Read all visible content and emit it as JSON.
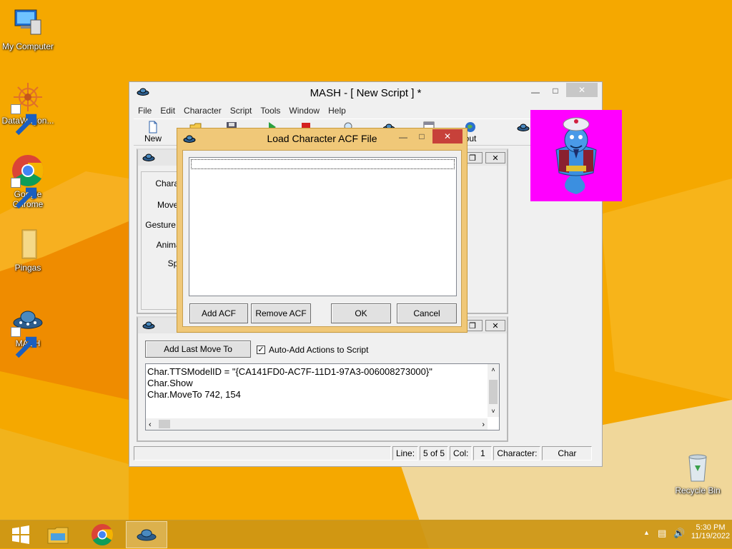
{
  "desktop": {
    "icons": [
      {
        "label": "My Computer"
      },
      {
        "label": "DataWagon..."
      },
      {
        "label": "Google Chrome"
      },
      {
        "label": "Pingas"
      },
      {
        "label": "MASH"
      },
      {
        "label": "Recycle Bin"
      }
    ]
  },
  "mash_window": {
    "title": "MASH - [ New Script ] *",
    "menu": [
      "File",
      "Edit",
      "Character",
      "Script",
      "Tools",
      "Window",
      "Help"
    ],
    "toolbar": {
      "new_label": "New",
      "about_label": "out"
    },
    "char_panel": {
      "labels": [
        "Charac",
        "Move t",
        "Gesture a",
        "Animat",
        "Spe"
      ]
    },
    "script_panel": {
      "add_last_move_label": "Add Last Move To",
      "auto_add_label": "Auto-Add Actions to Script",
      "auto_add_checked": true,
      "lines": [
        "Char.TTSModelID = \"{CA141FD0-AC7F-11D1-97A3-006008273000}\"",
        "Char.Show",
        "Char.MoveTo 742, 154"
      ]
    },
    "status": {
      "line_label": "Line:",
      "line_value": "5 of 5",
      "col_label": "Col:",
      "col_value": "1",
      "character_label": "Character:",
      "character_value": "Char"
    }
  },
  "dialog": {
    "title": "Load Character ACF File",
    "add_acf_label": "Add ACF",
    "remove_acf_label": "Remove ACF",
    "ok_label": "OK",
    "cancel_label": "Cancel"
  },
  "tray": {
    "time": "5:30 PM",
    "date": "11/19/2022"
  },
  "colors": {
    "desktop": "#f4a700",
    "dialog_frame": "#f0c878",
    "close_red": "#c7413a",
    "genie_bg": "#ff00ff"
  }
}
